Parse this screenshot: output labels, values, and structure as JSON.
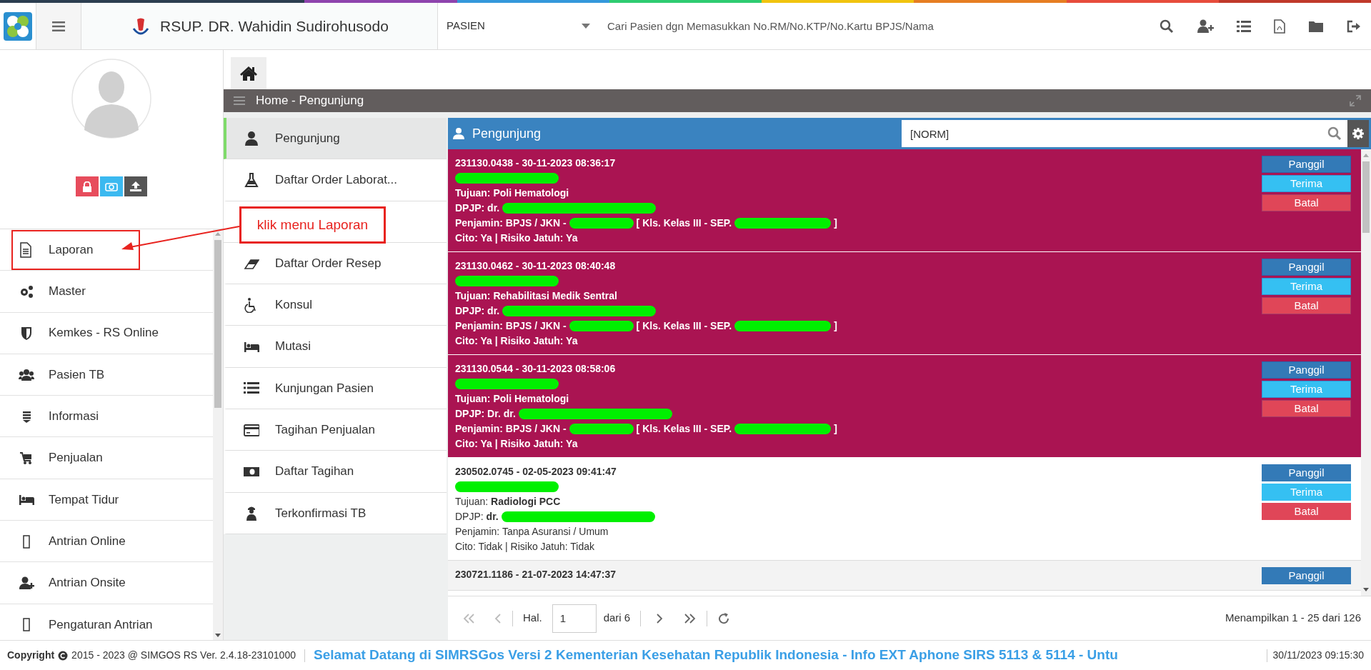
{
  "topbar": {
    "hospital_name": "RSUP. DR. Wahidin Sudirohusodo",
    "category_select": "PASIEN",
    "search": {
      "placeholder": "Cari Pasien dgn Memasukkan No.RM/No.KTP/No.Kartu BPJS/Nama"
    }
  },
  "sidebar": {
    "items": [
      {
        "label": "Laporan",
        "highlighted": true
      },
      {
        "label": "Master",
        "highlighted": false
      },
      {
        "label": "Kemkes - RS Online",
        "highlighted": false
      },
      {
        "label": "Pasien TB",
        "highlighted": false
      },
      {
        "label": "Informasi",
        "highlighted": false
      },
      {
        "label": "Penjualan",
        "highlighted": false
      },
      {
        "label": "Tempat Tidur",
        "highlighted": false
      },
      {
        "label": "Antrian Online",
        "highlighted": false
      },
      {
        "label": "Antrian Onsite",
        "highlighted": false
      },
      {
        "label": "Pengaturan Antrian",
        "highlighted": false
      }
    ]
  },
  "breadcrumb": "Home - Pengunjung",
  "submenu": {
    "items": [
      {
        "kind": "item",
        "label": "Pengunjung",
        "selected": true
      },
      {
        "kind": "item",
        "label": "Daftar Order Laborat...",
        "selected": false
      },
      {
        "kind": "covered"
      },
      {
        "kind": "item",
        "label": "Daftar Order Resep",
        "selected": false
      },
      {
        "kind": "item",
        "label": "Konsul",
        "selected": false
      },
      {
        "kind": "item",
        "label": "Mutasi",
        "selected": false
      },
      {
        "kind": "item",
        "label": "Kunjungan Pasien",
        "selected": false
      },
      {
        "kind": "item",
        "label": "Tagihan Penjualan",
        "selected": false
      },
      {
        "kind": "item",
        "label": "Daftar Tagihan",
        "selected": false
      },
      {
        "kind": "item",
        "label": "Terkonfirmasi TB",
        "selected": false
      }
    ]
  },
  "annotation": {
    "text": "klik menu Laporan"
  },
  "panel": {
    "title": "Pengunjung",
    "search_value": "[NORM]",
    "visits": [
      {
        "highlighted": true,
        "header": "231130.0438 - 30-11-2023 08:36:17",
        "lines": [
          [
            {
              "kind": "redaction"
            }
          ],
          [
            {
              "kind": "text",
              "text": "Tujuan: Poli Hematologi"
            }
          ],
          [
            {
              "kind": "text",
              "text": "DPJP: dr."
            },
            {
              "kind": "redaction"
            }
          ],
          [
            {
              "kind": "text",
              "text": "Penjamin: BPJS / JKN -"
            },
            {
              "kind": "redaction"
            },
            {
              "kind": "text",
              "text": "[ Kls. Kelas III - SEP."
            },
            {
              "kind": "redaction"
            },
            {
              "kind": "text",
              "text": "]"
            }
          ],
          [
            {
              "kind": "text",
              "text": "Cito: Ya | Risiko Jatuh: Ya"
            }
          ]
        ],
        "buttons": [
          "Panggil",
          "Terima",
          "Batal"
        ]
      },
      {
        "highlighted": true,
        "header": "231130.0462 - 30-11-2023 08:40:48",
        "lines": [
          [
            {
              "kind": "redaction"
            }
          ],
          [
            {
              "kind": "text",
              "text": "Tujuan: Rehabilitasi Medik Sentral"
            }
          ],
          [
            {
              "kind": "text",
              "text": "DPJP: dr."
            },
            {
              "kind": "redaction"
            }
          ],
          [
            {
              "kind": "text",
              "text": "Penjamin: BPJS / JKN -"
            },
            {
              "kind": "redaction"
            },
            {
              "kind": "text",
              "text": "[ Kls. Kelas III - SEP."
            },
            {
              "kind": "redaction"
            },
            {
              "kind": "text",
              "text": "]"
            }
          ],
          [
            {
              "kind": "text",
              "text": "Cito: Ya | Risiko Jatuh: Ya"
            }
          ]
        ],
        "buttons": [
          "Panggil",
          "Terima",
          "Batal"
        ]
      },
      {
        "highlighted": true,
        "header": "231130.0544 - 30-11-2023 08:58:06",
        "lines": [
          [
            {
              "kind": "redaction"
            }
          ],
          [
            {
              "kind": "text",
              "text": "Tujuan: Poli Hematologi"
            }
          ],
          [
            {
              "kind": "text",
              "text": "DPJP: Dr. dr."
            },
            {
              "kind": "redaction"
            }
          ],
          [
            {
              "kind": "text",
              "text": "Penjamin: BPJS / JKN -"
            },
            {
              "kind": "redaction"
            },
            {
              "kind": "text",
              "text": "[ Kls. Kelas III - SEP."
            },
            {
              "kind": "redaction"
            },
            {
              "kind": "text",
              "text": "]"
            }
          ],
          [
            {
              "kind": "text",
              "text": "Cito: Ya | Risiko Jatuh: Ya"
            }
          ]
        ],
        "buttons": [
          "Panggil",
          "Terima",
          "Batal"
        ]
      },
      {
        "highlighted": false,
        "header": "230502.0745 - 02-05-2023 09:41:47",
        "lines": [
          [
            {
              "kind": "redaction"
            }
          ],
          [
            {
              "kind": "text",
              "text": "Tujuan: **Radiologi PCC**"
            }
          ],
          [
            {
              "kind": "text",
              "text": "DPJP: **dr.**"
            },
            {
              "kind": "redaction"
            }
          ],
          [
            {
              "kind": "text",
              "text": "Penjamin: Tanpa Asuransi / Umum"
            }
          ],
          [
            {
              "kind": "text",
              "text": "Cito: Tidak | Risiko Jatuh: Tidak"
            }
          ]
        ],
        "buttons": [
          "Panggil",
          "Terima",
          "Batal"
        ]
      },
      {
        "highlighted": false,
        "header": "230721.1186 - 21-07-2023 14:47:37",
        "buttons": [
          "Panggil"
        ]
      }
    ]
  },
  "pagination": {
    "page_label": "Hal.",
    "page": "1",
    "of_pages": "dari 6",
    "summary": "Menampilkan 1 - 25 dari 126"
  },
  "footer": {
    "copyright": "Copyright",
    "copyright_rest": "2015 - 2023 @ SIMGOS RS Ver. 2.4.18-23101000",
    "ticker": "Selamat Datang di SIMRSGos Versi 2 Kementerian Kesehatan Republik Indonesia - Info EXT Aphone SIRS 5113 & 5114 - Untu",
    "datetime": "30/11/2023 09:15:30"
  }
}
